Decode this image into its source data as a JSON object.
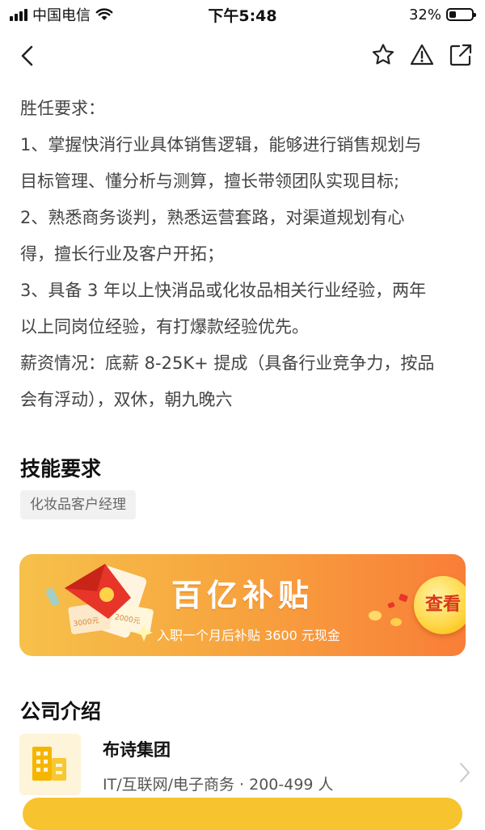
{
  "status": {
    "carrier": "中国电信",
    "time": "下午5:48",
    "battery_text": "32%",
    "battery_level": 0.32
  },
  "nav": {
    "icons": [
      "back-icon",
      "star-icon",
      "warning-icon",
      "share-icon"
    ]
  },
  "description": {
    "lines": [
      "胜任要求：",
      "1、掌握快消行业具体销售逻辑，能够进行销售规划与",
      "目标管理、懂分析与测算，擅长带领团队实现目标;",
      "2、熟悉商务谈判，熟悉运营套路，对渠道规划有心",
      "得，擅长行业及客户开拓；",
      "3、具备 3 年以上快消品或化妆品相关行业经验，两年",
      "以上同岗位经验，有打爆款经验优先。",
      "薪资情况：底薪 8-25K+ 提成（具备行业竞争力，按品",
      "会有浮动），双休，朝九晚六"
    ]
  },
  "skills": {
    "title": "技能要求",
    "tags": [
      "化妆品客户经理"
    ]
  },
  "banner": {
    "title": "百亿补贴",
    "subtitle": "入职一个月后补贴 3600 元现金",
    "button": "查看",
    "coupon_left": "3000元",
    "coupon_right": "2000元"
  },
  "company": {
    "section_title": "公司介绍",
    "name": "布诗集团",
    "info": "IT/互联网/电子商务 · 200-499 人"
  },
  "colors": {
    "accent": "#f7c32e",
    "banner_start": "#f6c14a",
    "banner_end": "#f97e38"
  }
}
